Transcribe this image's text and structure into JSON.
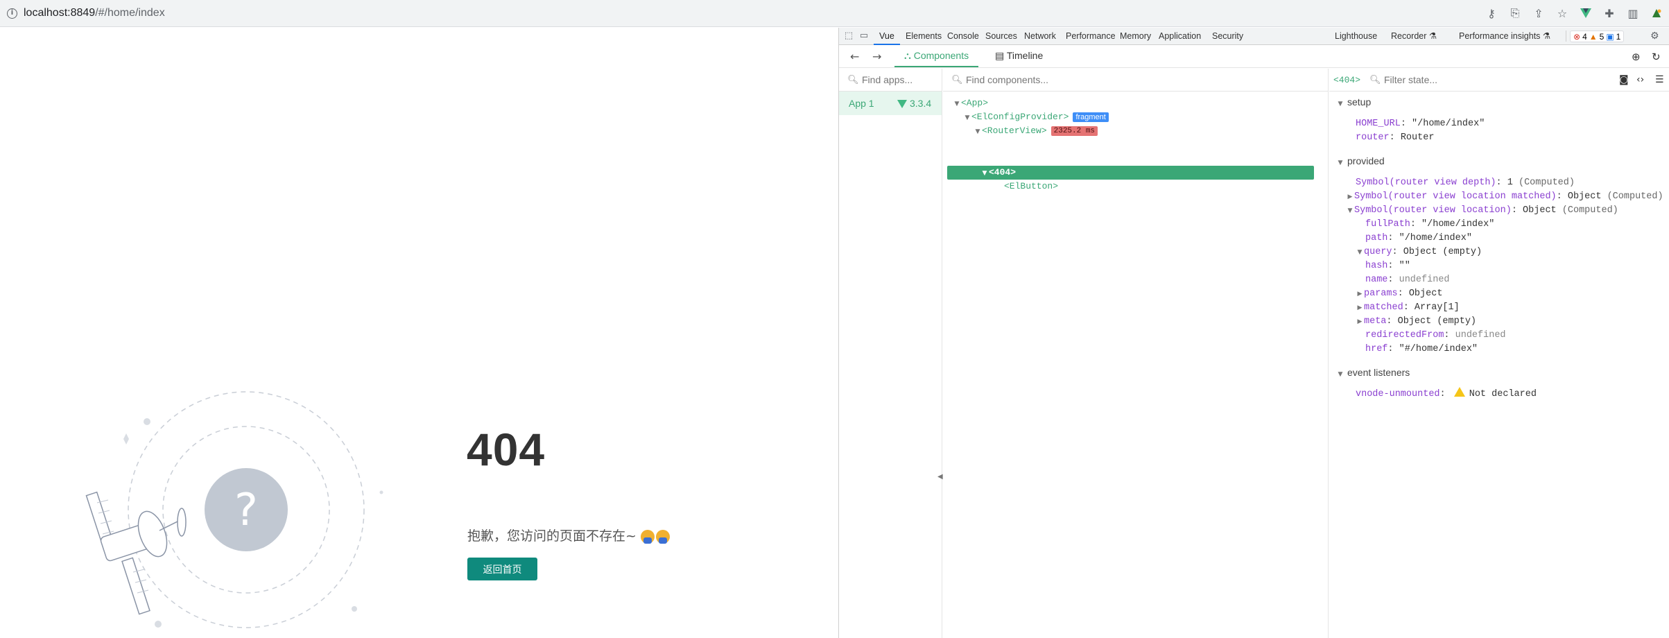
{
  "browser": {
    "url_host": "localhost:8849",
    "url_path": "/#/home/index",
    "toolbar_icons": [
      "key-icon",
      "translate-icon",
      "share-icon",
      "bookmark-star-icon",
      "vue-devtools-extension-icon",
      "extensions-puzzle-icon",
      "side-panel-icon",
      "profile-extension-icon"
    ]
  },
  "page": {
    "code": "404",
    "message": "抱歉，您访问的页面不存在~",
    "back_button": "返回首页"
  },
  "devtools": {
    "tabs": [
      "Vue",
      "Elements",
      "Console",
      "Sources",
      "Network",
      "Performance",
      "Memory",
      "Application",
      "Security",
      "Lighthouse",
      "Recorder ⚗",
      "Performance insights ⚗"
    ],
    "active_tab": "Vue",
    "badges": {
      "errors": "4",
      "warnings": "5",
      "info": "1"
    },
    "vue": {
      "subtabs": {
        "components": "Components",
        "timeline": "Timeline"
      },
      "find_apps_placeholder": "Find apps...",
      "find_components_placeholder": "Find components...",
      "app": {
        "name": "App 1",
        "version": "3.3.4"
      },
      "tree": {
        "app": "<App>",
        "config_provider": "<ElConfigProvider>",
        "fragment_chip": "fragment",
        "router_view": "<RouterView>",
        "time_chip": "2325.2 ms",
        "selected": "<404>",
        "button": "<ElButton>"
      },
      "inspector": {
        "tag": "<404>",
        "filter_placeholder": "Filter state...",
        "sections": {
          "setup": "setup",
          "provided": "provided",
          "events": "event listeners"
        },
        "setup": {
          "home_url_key": "HOME_URL",
          "home_url_val": "\"/home/index\"",
          "router_key": "router",
          "router_val": "Router"
        },
        "provided": {
          "depth_key": "Symbol(router view depth)",
          "depth_val": "1",
          "depth_tag": "(Computed)",
          "matched_key": "Symbol(router view location matched)",
          "matched_val": "Object",
          "matched_tag": "(Computed)",
          "location_key": "Symbol(router view location)",
          "location_val": "Object",
          "location_tag": "(Computed)",
          "fullpath_key": "fullPath",
          "fullpath_val": "\"/home/index\"",
          "path_key": "path",
          "path_val": "\"/home/index\"",
          "query_key": "query",
          "query_val": "Object (empty)",
          "hash_key": "hash",
          "hash_val": "\"\"",
          "name_key": "name",
          "name_val": "undefined",
          "params_key": "params",
          "params_val": "Object",
          "matched2_key": "matched",
          "matched2_val": "Array[1]",
          "meta_key": "meta",
          "meta_val": "Object (empty)",
          "redirected_key": "redirectedFrom",
          "redirected_val": "undefined",
          "href_key": "href",
          "href_val": "\"#/home/index\""
        },
        "events": {
          "key": "vnode-unmounted",
          "val": "Not declared"
        }
      }
    }
  },
  "colors": {
    "vue_green": "#3ba776",
    "button_teal": "#0f8a7d",
    "error_red": "#d93025",
    "warn_orange": "#e37400"
  }
}
